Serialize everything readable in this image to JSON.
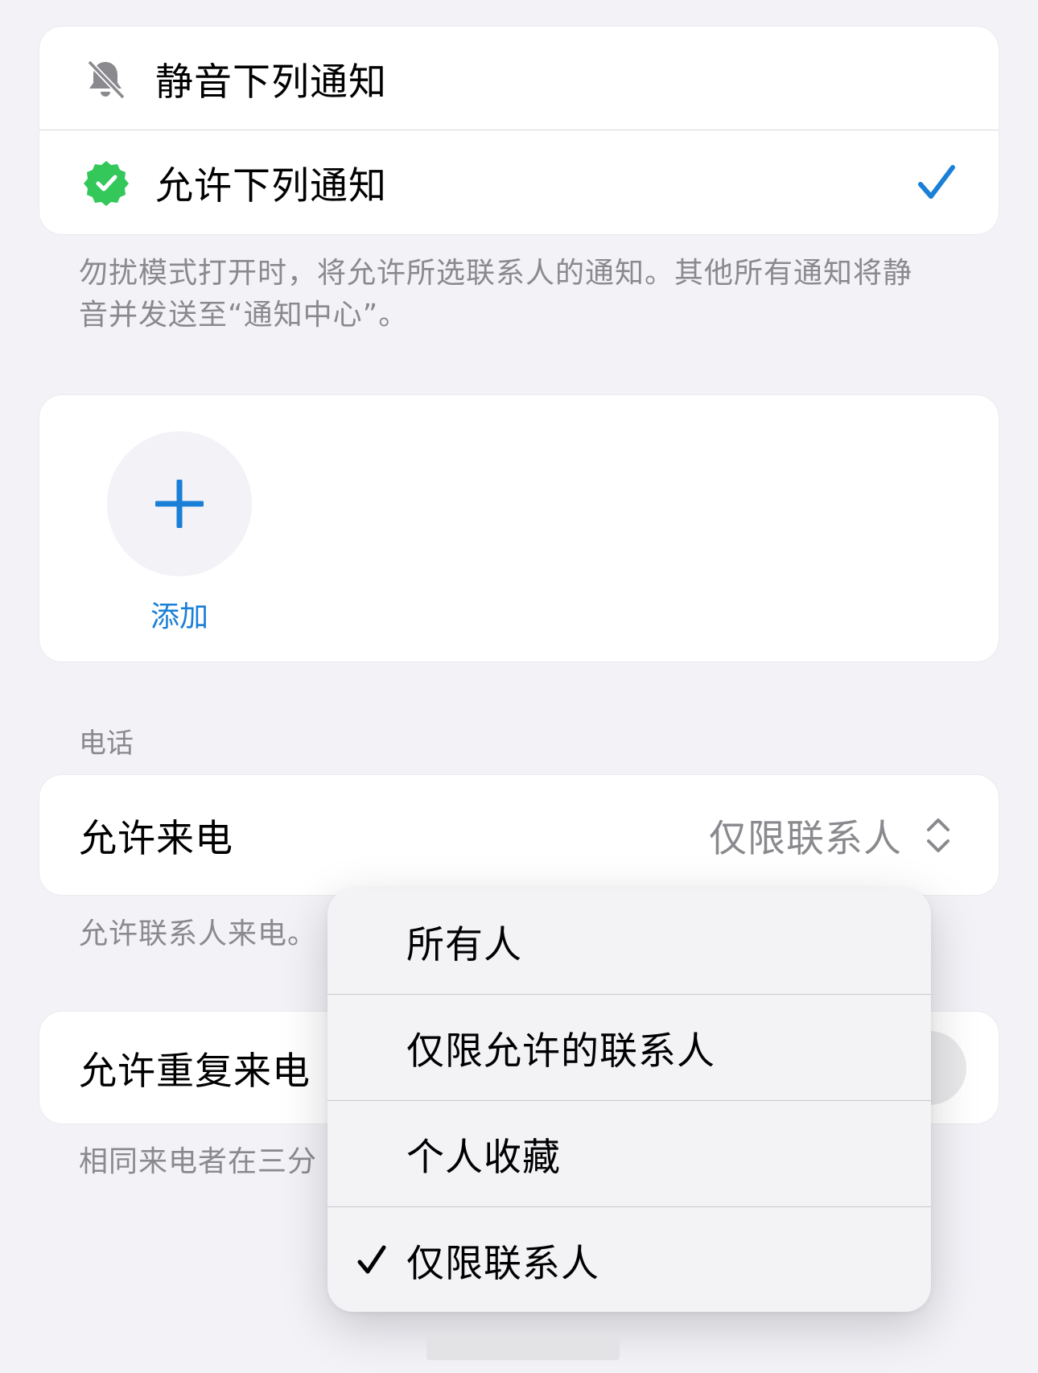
{
  "notifications_card": {
    "silence_label": "静音下列通知",
    "allow_label": "允许下列通知",
    "footnote": "勿扰模式打开时，将允许所选联系人的通知。其他所有通知将静音并发送至“通知中心”。"
  },
  "people_card": {
    "add_label": "添加"
  },
  "phone_section": {
    "header": "电话",
    "allow_calls_label": "允许来电",
    "allow_calls_value": "仅限联系人",
    "allow_calls_footnote": "允许联系人来电。",
    "repeated_calls_label": "允许重复来电",
    "repeated_calls_footnote": "相同来电者在三分"
  },
  "popup_menu": {
    "items": [
      {
        "label": "所有人",
        "selected": false
      },
      {
        "label": "仅限允许的联系人",
        "selected": false
      },
      {
        "label": "个人收藏",
        "selected": false
      },
      {
        "label": "仅限联系人",
        "selected": true
      }
    ]
  },
  "colors": {
    "accent_blue": "#1a7fd6",
    "badge_green": "#34c759",
    "secondary_gray": "#8a8a8e"
  }
}
